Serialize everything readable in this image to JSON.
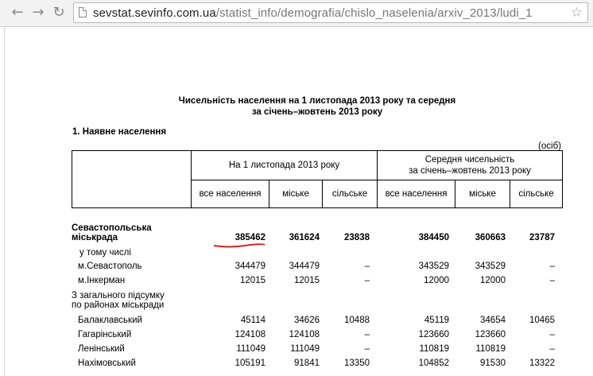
{
  "browser": {
    "back_icon": "arrow-left-icon",
    "forward_icon": "arrow-right-icon",
    "reload_icon": "reload-icon",
    "url_host": "sevstat.sevinfo.com.ua",
    "url_path": "/statist_info/demografia/chislo_naselenia/arxiv_2013/ludi_1",
    "star_icon": "star-icon"
  },
  "document": {
    "title_line1": "Чисельність населення на 1 листопада 2013 року та середня",
    "title_line2": "за січень–жовтень 2013 року",
    "section_title": "1. Наявне населення",
    "unit": "(осіб)",
    "headers": {
      "group1": "На 1 листопада 2013 року",
      "group2_line1": "Середня чисельність",
      "group2_line2": "за січень–жовтень 2013 року",
      "col_all": "все населення",
      "col_urban": "міське",
      "col_rural": "сільське",
      "col_all2": "все населення",
      "col_urban2": "міське",
      "col_rural2": "сільське"
    },
    "rows": [
      {
        "name_line1": "Севастопольська",
        "name_line2": "міськрада",
        "values": [
          "385462",
          "361624",
          "23838",
          "384450",
          "360663",
          "23787"
        ]
      },
      {
        "name": "у тому числі"
      },
      {
        "name": "м.Севастополь",
        "values": [
          "344479",
          "344479",
          "–",
          "343529",
          "343529",
          "–"
        ]
      },
      {
        "name": "м.Інкерман",
        "values": [
          "12015",
          "12015",
          "–",
          "12000",
          "12000",
          "–"
        ]
      },
      {
        "name_line1": "З загального підсумку",
        "name_line2": "по районах міськради"
      },
      {
        "name": "Балаклавський",
        "values": [
          "45114",
          "34626",
          "10488",
          "45119",
          "34654",
          "10465"
        ]
      },
      {
        "name": "Гагарінський",
        "values": [
          "124108",
          "124108",
          "–",
          "123660",
          "123660",
          "–"
        ]
      },
      {
        "name": "Ленінський",
        "values": [
          "111049",
          "111049",
          "–",
          "110819",
          "110819",
          "–"
        ]
      },
      {
        "name": "Нахімовський",
        "values": [
          "105191",
          "91841",
          "13350",
          "104852",
          "91530",
          "13322"
        ]
      }
    ],
    "highlight_color": "#d62020"
  }
}
